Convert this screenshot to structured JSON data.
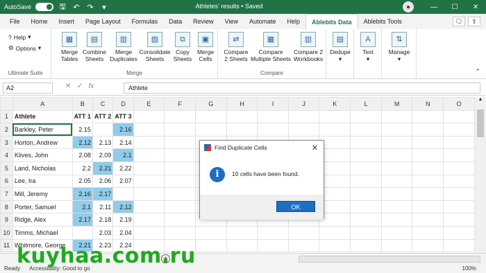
{
  "titlebar": {
    "autosave_label": "AutoSave",
    "autosave_state": "On",
    "document_title": "Athletes' results • Saved"
  },
  "menubar": {
    "tabs": [
      "File",
      "Home",
      "Insert",
      "Page Layout",
      "Formulas",
      "Data",
      "Review",
      "View",
      "Automate",
      "Help",
      "Ablebits Data",
      "Ablebits Tools"
    ],
    "active_tab": "Ablebits Data"
  },
  "ribbon": {
    "ultimate": {
      "help": "Help",
      "options": "Options",
      "group_label": "Ultimate Suite"
    },
    "merge": {
      "group_label": "Merge",
      "buttons": [
        {
          "line1": "Merge",
          "line2": "Tables"
        },
        {
          "line1": "Combine",
          "line2": "Sheets"
        },
        {
          "line1": "Merge",
          "line2": "Duplicates"
        },
        {
          "line1": "Consolidate",
          "line2": "Sheets"
        },
        {
          "line1": "Copy",
          "line2": "Sheets"
        },
        {
          "line1": "Merge",
          "line2": "Cells"
        }
      ]
    },
    "compare": {
      "group_label": "Compare",
      "buttons": [
        {
          "line1": "Compare",
          "line2": "2 Sheets"
        },
        {
          "line1": "Compare",
          "line2": "Multiple Sheets"
        },
        {
          "line1": "Compare 2",
          "line2": "Workbooks"
        }
      ]
    },
    "dedupe": "Dedupe",
    "text": "Text",
    "manage": "Manage"
  },
  "formula_bar": {
    "name_box": "A2",
    "fx": "fx",
    "value": "Athlete"
  },
  "grid": {
    "columns": [
      "A",
      "B",
      "C",
      "D",
      "E",
      "F",
      "G",
      "H",
      "I",
      "J",
      "K",
      "L",
      "M",
      "N",
      "O"
    ],
    "rows": [
      {
        "n": "1",
        "a": "Athlete",
        "b": "ATT 1",
        "c": "ATT 2",
        "d": "ATT 3"
      },
      {
        "n": "2",
        "a": "Barkley, Peter",
        "b": "2.15",
        "c": "",
        "d": "2.16"
      },
      {
        "n": "3",
        "a": "Horton, Andrew",
        "b": "2.12",
        "c": "2.13",
        "d": "2.14"
      },
      {
        "n": "4",
        "a": "Klives, John",
        "b": "2.08",
        "c": "2.09",
        "d": "2.1"
      },
      {
        "n": "5",
        "a": "Land, Nicholas",
        "b": "2.2",
        "c": "2.21",
        "d": "2.22"
      },
      {
        "n": "6",
        "a": "Lee, Ira",
        "b": "2.05",
        "c": "2.06",
        "d": "2.07"
      },
      {
        "n": "7",
        "a": "Mill, Jeremy",
        "b": "2.16",
        "c": "2.17",
        "d": ""
      },
      {
        "n": "8",
        "a": "Porter, Samuel",
        "b": "2.1",
        "c": "2.11",
        "d": "2.12"
      },
      {
        "n": "9",
        "a": "Ridge, Alex",
        "b": "2.17",
        "c": "2.18",
        "d": "2.19"
      },
      {
        "n": "10",
        "a": "Timms, Michael",
        "b": "",
        "c": "2.03",
        "d": "2.04"
      },
      {
        "n": "11",
        "a": "Whitmore, George",
        "b": "2.21",
        "c": "2.23",
        "d": "2.24"
      }
    ]
  },
  "dialog": {
    "title": "Find Duplicate Cells",
    "message": "10 cells have been found.",
    "ok": "OK"
  },
  "statusbar": {
    "ready": "Ready",
    "accessibility": "Accessibility: Good to go",
    "zoom": "100%"
  },
  "watermark": "kuyhaa.com.ru",
  "colors": {
    "excel_green": "#217346",
    "highlight": "#91ccea",
    "dialog_blue": "#1e6fc4"
  }
}
